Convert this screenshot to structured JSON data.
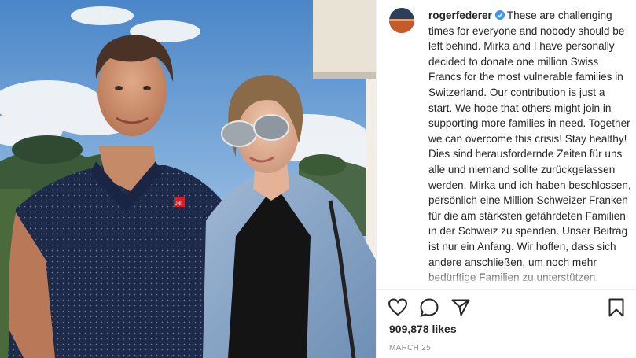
{
  "post": {
    "username": "rogerfederer",
    "caption": "These are challenging times for everyone and nobody should be left behind. Mirka and I have personally decided to donate one million Swiss Francs for the most vulnerable families in Switzerland. Our contribution is just a start. We hope that others might join in supporting more families in need. Together we can overcome this crisis! Stay healthy! Dies sind herausfordernde Zeiten für uns alle und niemand sollte zurückgelassen werden. Mirka und ich haben beschlossen, persönlich eine Million Schweizer Franken für die am stärksten gefährdeten Familien in der Schweiz zu spenden. Unser Beitrag ist nur ein Anfang. Wir hoffen, dass sich andere anschließen, um noch mehr bedürftige Familien zu unterstützen.",
    "likes": "909,878 likes",
    "date": "MARCH 25",
    "shirt_logo": "UNI"
  },
  "icons": {
    "verified": "verified-badge-icon",
    "like": "heart-icon",
    "comment": "comment-bubble-icon",
    "share": "paper-plane-icon",
    "save": "bookmark-icon"
  },
  "colors": {
    "verified": "#3897f0",
    "text": "#262626",
    "muted": "#8e8e8e"
  }
}
